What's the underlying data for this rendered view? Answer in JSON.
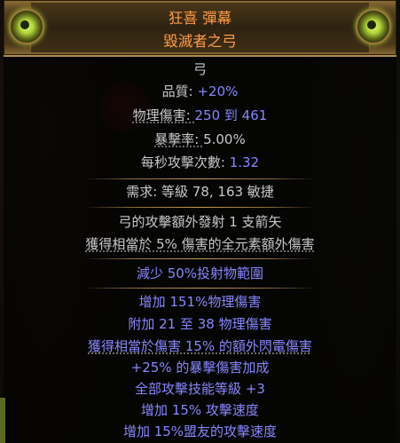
{
  "item": {
    "name": "狂喜 彈幕",
    "base_type": "毀滅者之弓"
  },
  "properties": {
    "item_class": "弓",
    "quality_label": "品質: ",
    "quality_value": "+20%",
    "phys_label": "物理傷害: ",
    "phys_value": "250 到 461",
    "crit_label": "暴擊率: ",
    "crit_value": "5.00%",
    "aps_label": "每秒攻擊次數: ",
    "aps_value": "1.32"
  },
  "requirements": {
    "text": "需求: 等級 78, 163 敏捷"
  },
  "implicits": [
    "弓的攻擊額外發射 1 支箭矢",
    "獲得相當於 5% 傷害的全元素額外傷害"
  ],
  "enchant": "減少 50%投射物範圍",
  "explicits": [
    "增加 151%物理傷害",
    "附加 21 至 38 物理傷害",
    "獲得相當於傷害 15% 的額外閃電傷害",
    "+25% 的暴擊傷害加成",
    "全部攻擊技能等級 +3",
    "增加 15% 攻擊速度",
    "增加 15%盟友的攻擊速度"
  ],
  "colors": {
    "unique_name": "#ff9c48",
    "magic_value": "#8888ff",
    "default_text": "#c8c8c8",
    "separator": "#c39c52"
  },
  "icons": [
    "left-orb-ornament-icon",
    "right-orb-ornament-icon"
  ]
}
